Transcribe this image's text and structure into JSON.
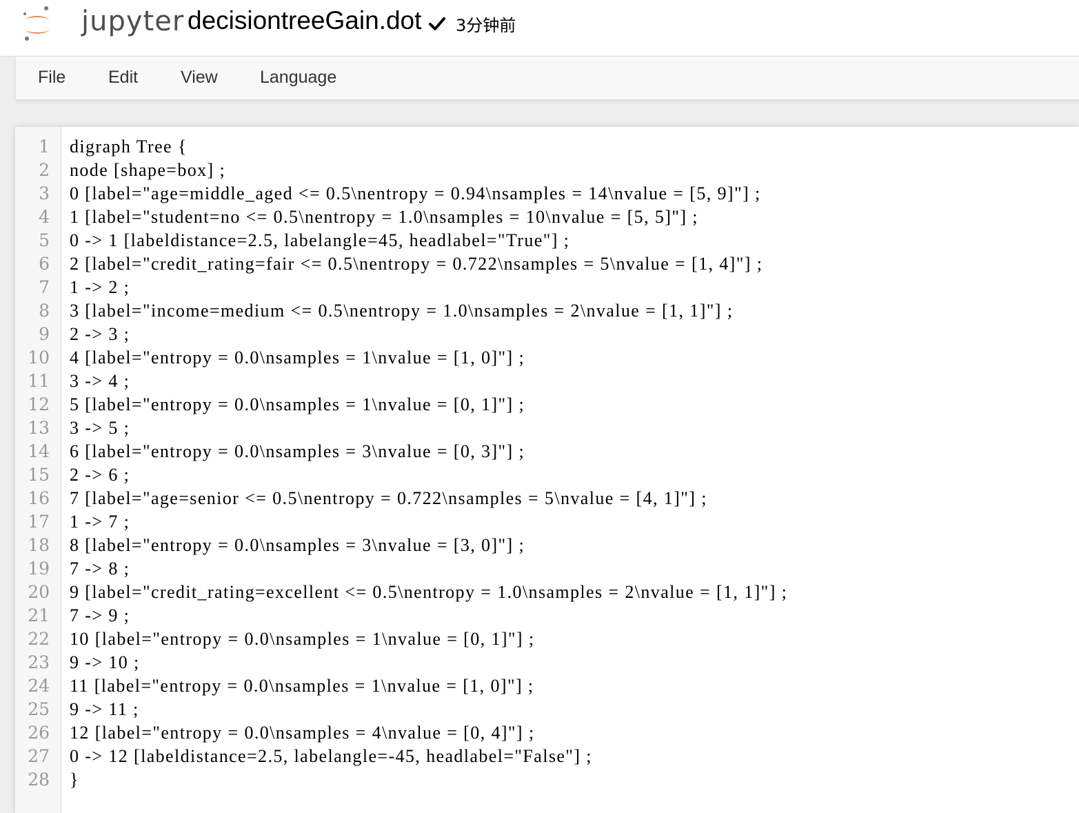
{
  "header": {
    "logo_text": "jupyter",
    "filename": "decisiontreeGain.dot",
    "save_icon": "checkmark-icon",
    "save_status": "3分钟前",
    "logo_colors": {
      "orange": "#F37726",
      "gray": "#767677"
    }
  },
  "menu": {
    "items": [
      {
        "label": "File"
      },
      {
        "label": "Edit"
      },
      {
        "label": "View"
      },
      {
        "label": "Language"
      }
    ]
  },
  "editor": {
    "lines": [
      {
        "n": "1",
        "text": "digraph Tree {"
      },
      {
        "n": "2",
        "text": "node [shape=box] ;"
      },
      {
        "n": "3",
        "text": "0 [label=\"age=middle_aged <= 0.5\\nentropy = 0.94\\nsamples = 14\\nvalue = [5, 9]\"] ;"
      },
      {
        "n": "4",
        "text": "1 [label=\"student=no <= 0.5\\nentropy = 1.0\\nsamples = 10\\nvalue = [5, 5]\"] ;"
      },
      {
        "n": "5",
        "text": "0 -> 1 [labeldistance=2.5, labelangle=45, headlabel=\"True\"] ;"
      },
      {
        "n": "6",
        "text": "2 [label=\"credit_rating=fair <= 0.5\\nentropy = 0.722\\nsamples = 5\\nvalue = [1, 4]\"] ;"
      },
      {
        "n": "7",
        "text": "1 -> 2 ;"
      },
      {
        "n": "8",
        "text": "3 [label=\"income=medium <= 0.5\\nentropy = 1.0\\nsamples = 2\\nvalue = [1, 1]\"] ;"
      },
      {
        "n": "9",
        "text": "2 -> 3 ;"
      },
      {
        "n": "10",
        "text": "4 [label=\"entropy = 0.0\\nsamples = 1\\nvalue = [1, 0]\"] ;"
      },
      {
        "n": "11",
        "text": "3 -> 4 ;"
      },
      {
        "n": "12",
        "text": "5 [label=\"entropy = 0.0\\nsamples = 1\\nvalue = [0, 1]\"] ;"
      },
      {
        "n": "13",
        "text": "3 -> 5 ;"
      },
      {
        "n": "14",
        "text": "6 [label=\"entropy = 0.0\\nsamples = 3\\nvalue = [0, 3]\"] ;"
      },
      {
        "n": "15",
        "text": "2 -> 6 ;"
      },
      {
        "n": "16",
        "text": "7 [label=\"age=senior <= 0.5\\nentropy = 0.722\\nsamples = 5\\nvalue = [4, 1]\"] ;"
      },
      {
        "n": "17",
        "text": "1 -> 7 ;"
      },
      {
        "n": "18",
        "text": "8 [label=\"entropy = 0.0\\nsamples = 3\\nvalue = [3, 0]\"] ;"
      },
      {
        "n": "19",
        "text": "7 -> 8 ;"
      },
      {
        "n": "20",
        "text": "9 [label=\"credit_rating=excellent <= 0.5\\nentropy = 1.0\\nsamples = 2\\nvalue = [1, 1]\"] ;"
      },
      {
        "n": "21",
        "text": "7 -> 9 ;"
      },
      {
        "n": "22",
        "text": "10 [label=\"entropy = 0.0\\nsamples = 1\\nvalue = [0, 1]\"] ;"
      },
      {
        "n": "23",
        "text": "9 -> 10 ;"
      },
      {
        "n": "24",
        "text": "11 [label=\"entropy = 0.0\\nsamples = 1\\nvalue = [1, 0]\"] ;"
      },
      {
        "n": "25",
        "text": "9 -> 11 ;"
      },
      {
        "n": "26",
        "text": "12 [label=\"entropy = 0.0\\nsamples = 4\\nvalue = [0, 4]\"] ;"
      },
      {
        "n": "27",
        "text": "0 -> 12 [labeldistance=2.5, labelangle=-45, headlabel=\"False\"] ;"
      },
      {
        "n": "28",
        "text": "}"
      }
    ]
  }
}
